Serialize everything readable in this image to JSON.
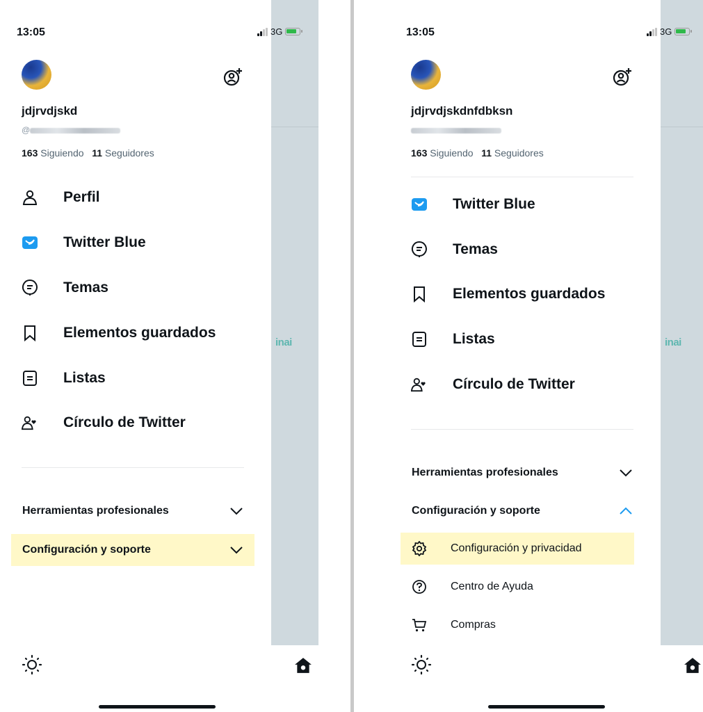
{
  "colors": {
    "accent_blue": "#1d9bf0",
    "highlight": "#fff8c8",
    "text": "#0f1419",
    "muted": "#536471"
  },
  "left": {
    "status": {
      "time": "13:05",
      "network": "3G"
    },
    "profile": {
      "name": "jdjrvdjskd",
      "handle_prefix": "@",
      "following_count": "163",
      "following_label": "Siguiendo",
      "followers_count": "11",
      "followers_label": "Seguidores"
    },
    "menu": [
      {
        "label": "Perfil",
        "icon": "person-icon"
      },
      {
        "label": "Twitter Blue",
        "icon": "twitter-blue-icon"
      },
      {
        "label": "Temas",
        "icon": "topics-icon"
      },
      {
        "label": "Elementos guardados",
        "icon": "bookmark-icon"
      },
      {
        "label": "Listas",
        "icon": "list-icon"
      },
      {
        "label": "Círculo de Twitter",
        "icon": "circle-icon"
      }
    ],
    "sections": [
      {
        "label": "Herramientas profesionales",
        "expanded": false
      },
      {
        "label": "Configuración y soporte",
        "expanded": false
      }
    ],
    "peek_text": "inai"
  },
  "right": {
    "status": {
      "time": "13:05",
      "network": "3G"
    },
    "profile": {
      "name": "jdjrvdjskdnfdbksn",
      "following_count": "163",
      "following_label": "Siguiendo",
      "followers_count": "11",
      "followers_label": "Seguidores"
    },
    "menu": [
      {
        "label": "Twitter Blue",
        "icon": "twitter-blue-icon"
      },
      {
        "label": "Temas",
        "icon": "topics-icon"
      },
      {
        "label": "Elementos guardados",
        "icon": "bookmark-icon"
      },
      {
        "label": "Listas",
        "icon": "list-icon"
      },
      {
        "label": "Círculo de Twitter",
        "icon": "circle-icon"
      }
    ],
    "sections": [
      {
        "label": "Herramientas profesionales",
        "expanded": false
      },
      {
        "label": "Configuración y soporte",
        "expanded": true
      }
    ],
    "submenu": [
      {
        "label": "Configuración y privacidad",
        "icon": "gear-icon"
      },
      {
        "label": "Centro de Ayuda",
        "icon": "help-icon"
      },
      {
        "label": "Compras",
        "icon": "cart-icon"
      }
    ],
    "peek_text": "inai"
  }
}
